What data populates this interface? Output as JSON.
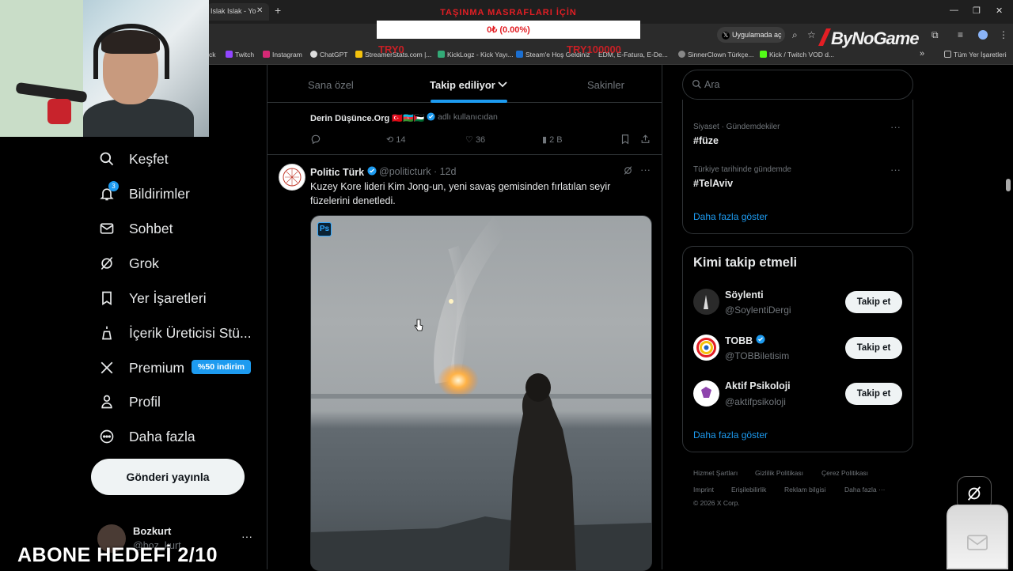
{
  "browser": {
    "active_tab_title": "Islak Islak - Yo",
    "open_app_button": "Uygulamada aç",
    "bookmarks": [
      "Twitch",
      "Instagram",
      "ChatGPT",
      "StreamerStats.com |...",
      "KickLogz - Kick Yayı...",
      "Steam'e Hoş Geldiniz",
      "EDM, E-Fatura, E-De...",
      "SinnerClown Türkçe...",
      "Kick / Twitch VOD d..."
    ],
    "all_bookmarks": "Tüm Yer İşaretleri",
    "left_bookmark_fragment": "ck"
  },
  "overlay": {
    "title": "TAŞINMA MASRAFLARI İÇİN",
    "progress_text": "0₺ (0.00%)",
    "progress": 0,
    "left_label": "TRY0",
    "right_label": "TRY100000",
    "sponsor_logo": "ByNoGame",
    "subscriber_goal": "ABONE HEDEFİ 2/10"
  },
  "sidebar": {
    "items": [
      {
        "label": "Keşfet",
        "icon": "search-icon"
      },
      {
        "label": "Bildirimler",
        "icon": "bell-icon",
        "badge": "3"
      },
      {
        "label": "Sohbet",
        "icon": "mail-icon"
      },
      {
        "label": "Grok",
        "icon": "grok-icon"
      },
      {
        "label": "Yer İşaretleri",
        "icon": "bookmark-icon"
      },
      {
        "label": "İçerik Üreticisi Stü...",
        "icon": "creator-icon"
      },
      {
        "label": "Premium",
        "icon": "x-logo-icon",
        "badge": "%50 indirim"
      },
      {
        "label": "Profil",
        "icon": "person-icon"
      },
      {
        "label": "Daha fazla",
        "icon": "more-circle-icon"
      }
    ],
    "post_button": "Gönderi yayınla",
    "account": {
      "name": "Bozkurt",
      "handle": "@boz_kurt"
    }
  },
  "feed": {
    "tabs": [
      "Sana özel",
      "Takip ediliyor",
      "Sakinler"
    ],
    "active_tab": "Takip ediliyor",
    "previous_post": {
      "author": "Derin Düşünce.Org",
      "flags": "🇹🇷🇦🇿🇵🇸",
      "sub": "adlı kullanıcıdan",
      "reposts": "14",
      "likes": "36",
      "views": "2 B"
    },
    "post": {
      "name": "Politic Türk",
      "handle": "@politicturk · 12d",
      "text": "Kuzey Kore lideri Kim Jong-un, yeni savaş gemisinden fırlatılan seyir füzelerini denetledi.",
      "media_badge": "Ps"
    }
  },
  "right": {
    "search_placeholder": "Ara",
    "trends": [
      {
        "category": "Siyaset · Gündemdekiler",
        "name": "#füze"
      },
      {
        "category": "Türkiye tarihinde gündemde",
        "name": "#TelAviv"
      }
    ],
    "trends_show_more": "Daha fazla göster",
    "who_to_follow": {
      "title": "Kimi takip etmeli",
      "accounts": [
        {
          "name": "Söylenti",
          "handle": "@SoylentiDergi",
          "verified": false
        },
        {
          "name": "TOBB",
          "handle": "@TOBBiletisim",
          "verified": true
        },
        {
          "name": "Aktif Psikoloji",
          "handle": "@aktifpsikoloji",
          "verified": false
        }
      ],
      "follow_label": "Takip et",
      "show_more": "Daha fazla göster"
    },
    "footer": [
      "Hizmet Şartları",
      "Gizlilik Politikası",
      "Çerez Politikası",
      "Imprint",
      "Erişilebilirlik",
      "Reklam bilgisi",
      "Daha fazla ···",
      "© 2026 X Corp."
    ]
  },
  "colors": {
    "accent": "#1d9bf0",
    "overlay_red": "#e31e24",
    "background": "#000000"
  }
}
